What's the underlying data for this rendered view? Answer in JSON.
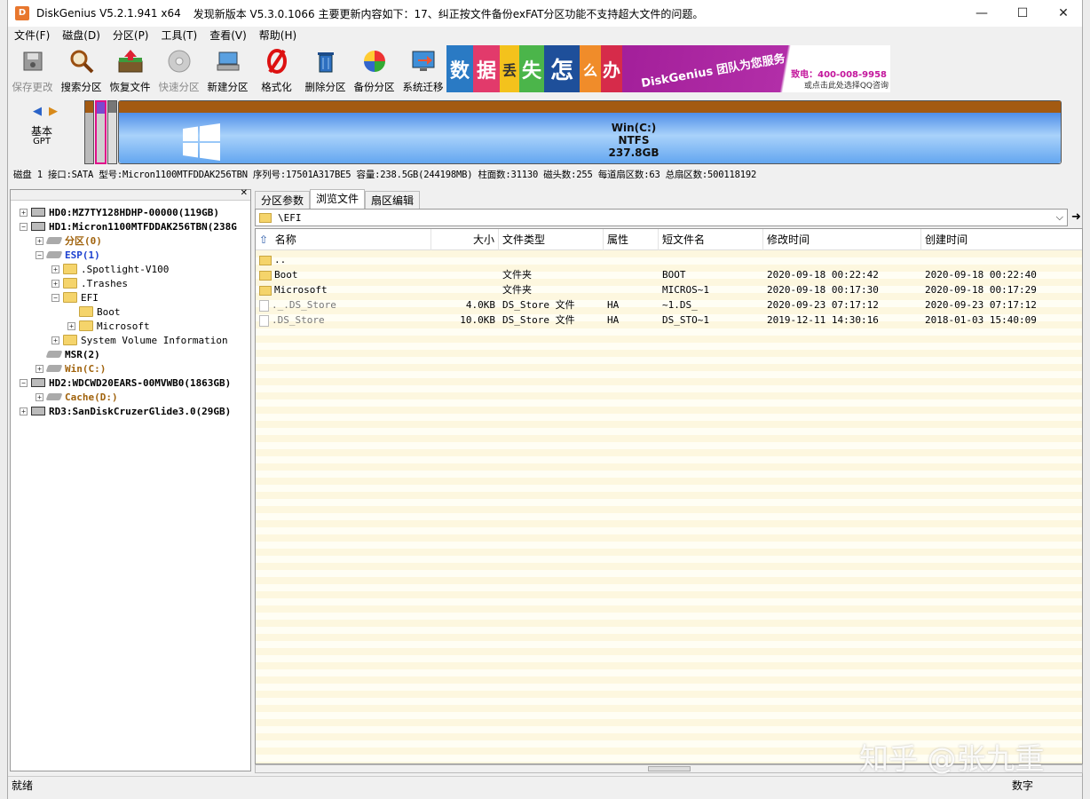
{
  "app": {
    "title": "DiskGenius V5.2.1.941 x64",
    "update_notice": "发现新版本 V5.3.0.1066 主要更新内容如下：17、纠正按文件备份exFAT分区功能不支持超大文件的问题。",
    "minimize": "—",
    "maximize": "☐",
    "close": "✕"
  },
  "menu": [
    "文件(F)",
    "磁盘(D)",
    "分区(P)",
    "工具(T)",
    "查看(V)",
    "帮助(H)"
  ],
  "toolbar": [
    {
      "label": "保存更改",
      "icon": "save-icon",
      "disabled": true
    },
    {
      "label": "搜索分区",
      "icon": "search-icon",
      "disabled": false
    },
    {
      "label": "恢复文件",
      "icon": "recover-icon",
      "disabled": false
    },
    {
      "label": "快速分区",
      "icon": "quick-partition-icon",
      "disabled": true
    },
    {
      "label": "新建分区",
      "icon": "new-partition-icon",
      "disabled": false
    },
    {
      "label": "格式化",
      "icon": "format-icon",
      "disabled": false
    },
    {
      "label": "删除分区",
      "icon": "delete-icon",
      "disabled": false
    },
    {
      "label": "备份分区",
      "icon": "backup-icon",
      "disabled": false
    },
    {
      "label": "系统迁移",
      "icon": "migrate-icon",
      "disabled": false
    }
  ],
  "banner": {
    "chars": [
      "数",
      "据",
      "丢",
      "失",
      "怎",
      "么",
      "办"
    ],
    "slogan": "DiskGenius 团队为您服务",
    "phone": "致电：400-008-9958",
    "qq": "或点击此处选择QQ咨询"
  },
  "diskmap": {
    "basic": "基本",
    "gpt": "GPT",
    "partition_name": "Win(C:)",
    "partition_fs": "NTFS",
    "partition_size": "237.8GB"
  },
  "diskinfo": "磁盘 1 接口:SATA  型号:Micron1100MTFDDAK256TBN  序列号:17501A317BE5  容量:238.5GB(244198MB)  柱面数:31130  磁头数:255  每道扇区数:63  总扇区数:500118192",
  "tree": [
    {
      "label": "HD0:MZ7TY128HDHP-00000(119GB)",
      "pm": "+",
      "icon": "hdd",
      "style": "t-bold"
    },
    {
      "label": "HD1:Micron1100MTFDDAK256TBN(238G",
      "pm": "−",
      "icon": "hdd",
      "style": "t-bold"
    },
    {
      "label": "分区(0)",
      "pm": "+",
      "icon": "part",
      "style": "t-brown"
    },
    {
      "label": "ESP(1)",
      "pm": "−",
      "icon": "part",
      "style": "t-blue"
    },
    {
      "label": ".Spotlight-V100",
      "pm": "+",
      "icon": "folder",
      "style": ""
    },
    {
      "label": ".Trashes",
      "pm": "+",
      "icon": "folder",
      "style": ""
    },
    {
      "label": "EFI",
      "pm": "−",
      "icon": "folder",
      "style": ""
    },
    {
      "label": "Boot",
      "pm": "",
      "icon": "folder",
      "style": ""
    },
    {
      "label": "Microsoft",
      "pm": "+",
      "icon": "folder",
      "style": ""
    },
    {
      "label": "System Volume Information",
      "pm": "+",
      "icon": "folder",
      "style": ""
    },
    {
      "label": "MSR(2)",
      "pm": "",
      "icon": "part",
      "style": "t-bold"
    },
    {
      "label": "Win(C:)",
      "pm": "+",
      "icon": "part",
      "style": "t-brown"
    },
    {
      "label": "HD2:WDCWD20EARS-00MVWB0(1863GB)",
      "pm": "−",
      "icon": "hdd",
      "style": "t-bold"
    },
    {
      "label": "Cache(D:)",
      "pm": "+",
      "icon": "part",
      "style": "t-brown"
    },
    {
      "label": "RD3:SanDiskCruzerGlide3.0(29GB)",
      "pm": "+",
      "icon": "hdd",
      "style": "t-bold"
    }
  ],
  "tabs": [
    "分区参数",
    "浏览文件",
    "扇区编辑"
  ],
  "path": "\\EFI",
  "columns": [
    "名称",
    "大小",
    "文件类型",
    "属性",
    "短文件名",
    "修改时间",
    "创建时间"
  ],
  "files": [
    {
      "name": "..",
      "size": "",
      "type": "",
      "attr": "",
      "short": "",
      "mtime": "",
      "ctime": "",
      "kind": "folder",
      "grey": false
    },
    {
      "name": "Boot",
      "size": "",
      "type": "文件夹",
      "attr": "",
      "short": "BOOT",
      "mtime": "2020-09-18 00:22:42",
      "ctime": "2020-09-18 00:22:40",
      "kind": "folder",
      "grey": false
    },
    {
      "name": "Microsoft",
      "size": "",
      "type": "文件夹",
      "attr": "",
      "short": "MICROS~1",
      "mtime": "2020-09-18 00:17:30",
      "ctime": "2020-09-18 00:17:29",
      "kind": "folder",
      "grey": false
    },
    {
      "name": "._.DS_Store",
      "size": "4.0KB",
      "type": "DS_Store 文件",
      "attr": "HA",
      "short": "~1.DS_",
      "mtime": "2020-09-23 07:17:12",
      "ctime": "2020-09-23 07:17:12",
      "kind": "file",
      "grey": true
    },
    {
      "name": ".DS_Store",
      "size": "10.0KB",
      "type": "DS_Store 文件",
      "attr": "HA",
      "short": "DS_STO~1",
      "mtime": "2019-12-11 14:30:16",
      "ctime": "2018-01-03 15:40:09",
      "kind": "file",
      "grey": true
    }
  ],
  "status": {
    "left": "就绪",
    "mode": "数字"
  },
  "watermark": "知乎 @张九重"
}
